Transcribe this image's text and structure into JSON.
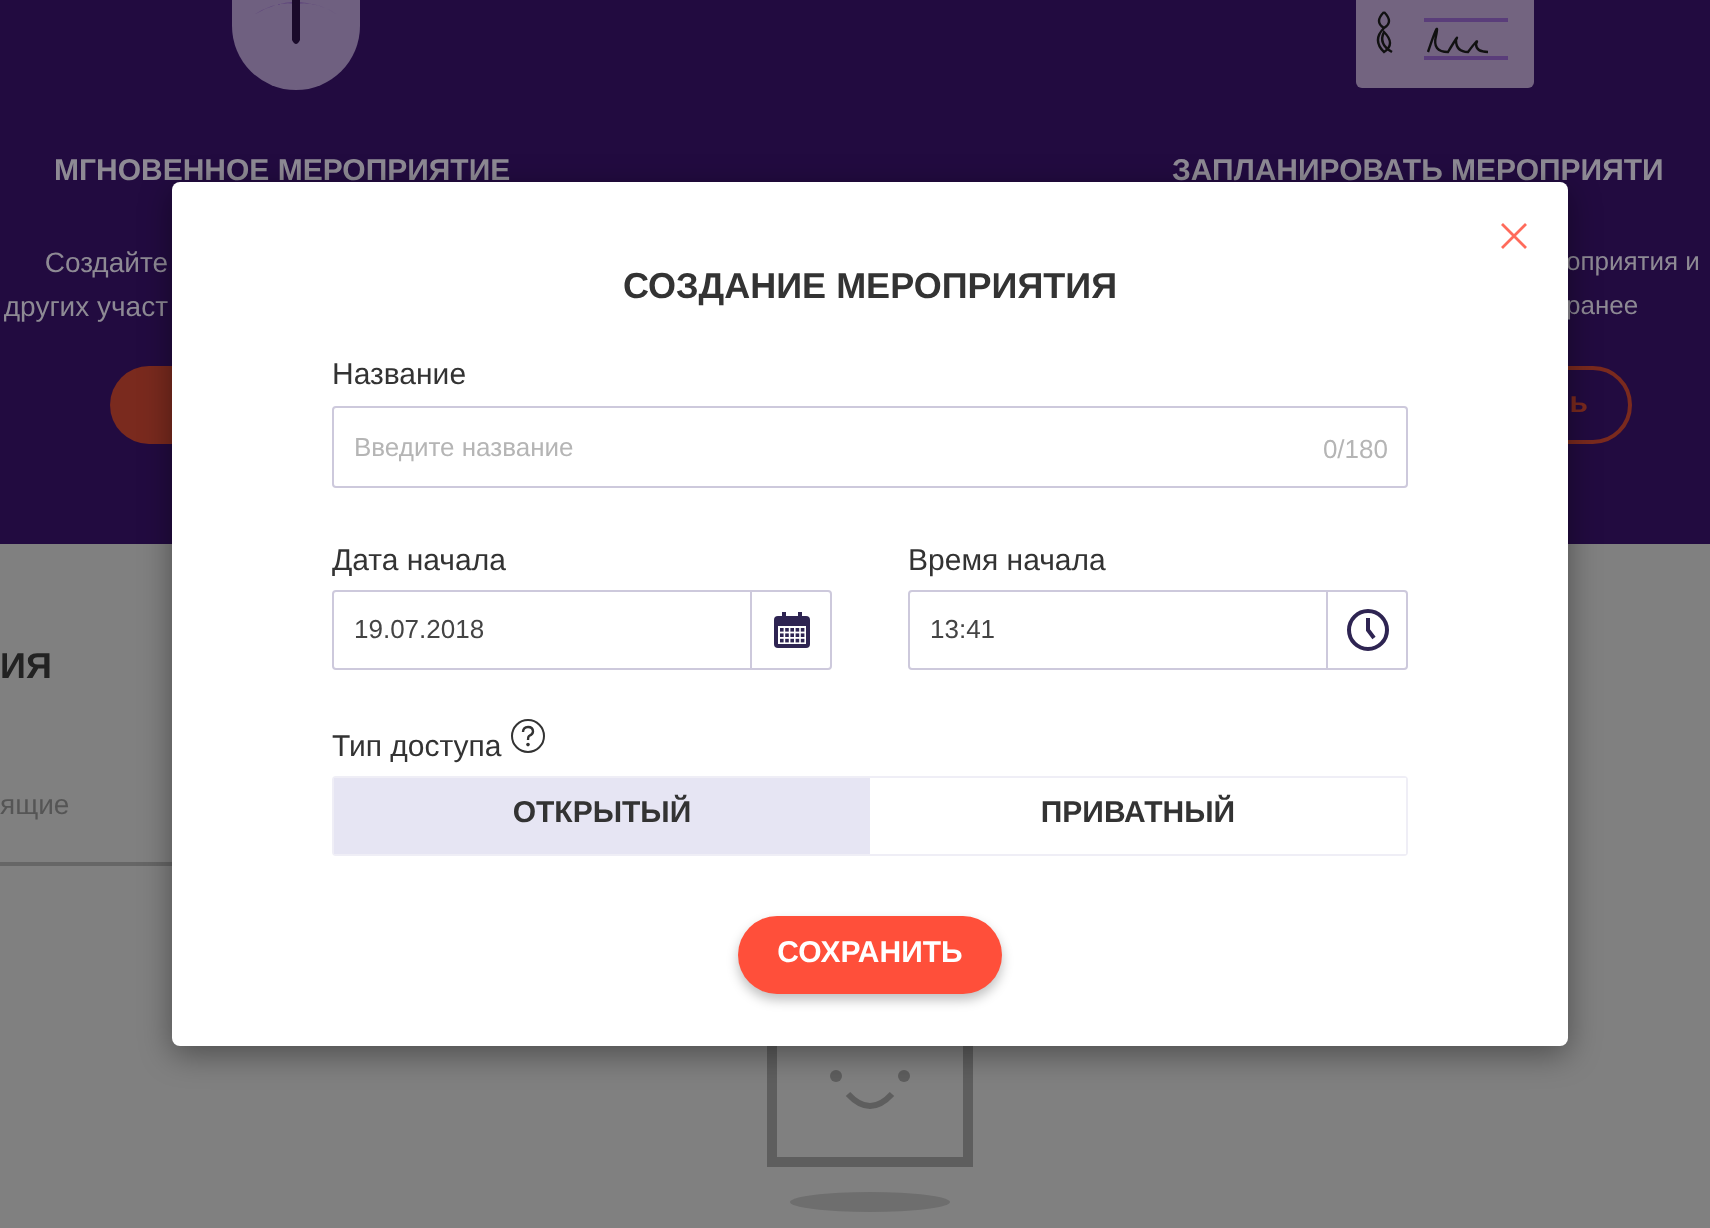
{
  "background": {
    "left_card": {
      "title": "МГНОВЕННОЕ МЕРОПРИЯТИЕ",
      "description_lines": [
        "Создайте",
        "других участ"
      ]
    },
    "right_card": {
      "title": "ЗАПЛАНИРОВАТЬ МЕРОПРИЯТИ",
      "description_lines": [
        "оприятия и",
        "ранее"
      ],
      "button_label": "ь"
    },
    "section_title": "ИЯ",
    "tab_label": "ящие"
  },
  "dialog": {
    "title": "СОЗДАНИЕ МЕРОПРИЯТИЯ",
    "name_field": {
      "label": "Название",
      "placeholder": "Введите название",
      "counter": "0/180"
    },
    "date_fields": [
      {
        "kind": "date",
        "label": "Дата начала",
        "value": "19.07.2018"
      },
      {
        "kind": "time",
        "label": "Время начала",
        "value": "13:41"
      }
    ],
    "access": {
      "label": "Тип доступа",
      "options": [
        {
          "label": "ОТКРЫТЫЙ",
          "selected": true
        },
        {
          "label": "ПРИВАТНЫЙ",
          "selected": false
        }
      ]
    },
    "save_button": "СОХРАНИТЬ"
  }
}
